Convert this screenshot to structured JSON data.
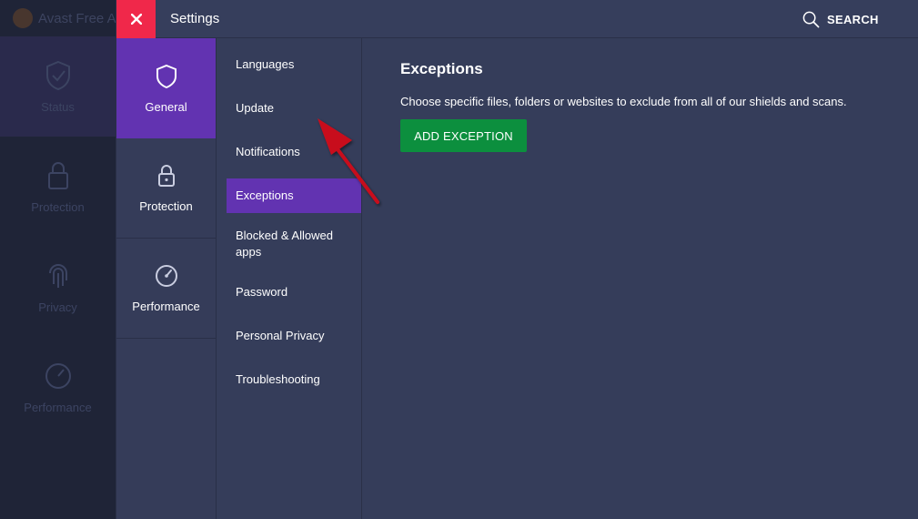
{
  "background_app": {
    "title": "Avast Free A",
    "nav": [
      {
        "label": "Status",
        "icon": "shield-check-icon"
      },
      {
        "label": "Protection",
        "icon": "lock-icon"
      },
      {
        "label": "Privacy",
        "icon": "fingerprint-icon"
      },
      {
        "label": "Performance",
        "icon": "speedometer-icon"
      }
    ]
  },
  "settings": {
    "title": "Settings",
    "search_label": "SEARCH",
    "categories": [
      {
        "label": "General",
        "icon": "shield-icon",
        "active": true
      },
      {
        "label": "Protection",
        "icon": "lock-icon",
        "active": false
      },
      {
        "label": "Performance",
        "icon": "speedometer-icon",
        "active": false
      }
    ],
    "submenu": [
      {
        "label": "Languages"
      },
      {
        "label": "Update"
      },
      {
        "label": "Notifications"
      },
      {
        "label": "Exceptions",
        "active": true
      },
      {
        "label": "Blocked & Allowed apps"
      },
      {
        "label": "Password"
      },
      {
        "label": "Personal Privacy"
      },
      {
        "label": "Troubleshooting"
      }
    ],
    "content": {
      "title": "Exceptions",
      "description": "Choose specific files, folders or websites to exclude from all of our shields and scans.",
      "add_button_label": "ADD EXCEPTION"
    }
  },
  "colors": {
    "close_button": "#f0284a",
    "active_purple": "#6233b1",
    "add_button_green": "#0c8f3e",
    "panel_bg": "#353d5a",
    "annotation_arrow": "#c8101c"
  }
}
